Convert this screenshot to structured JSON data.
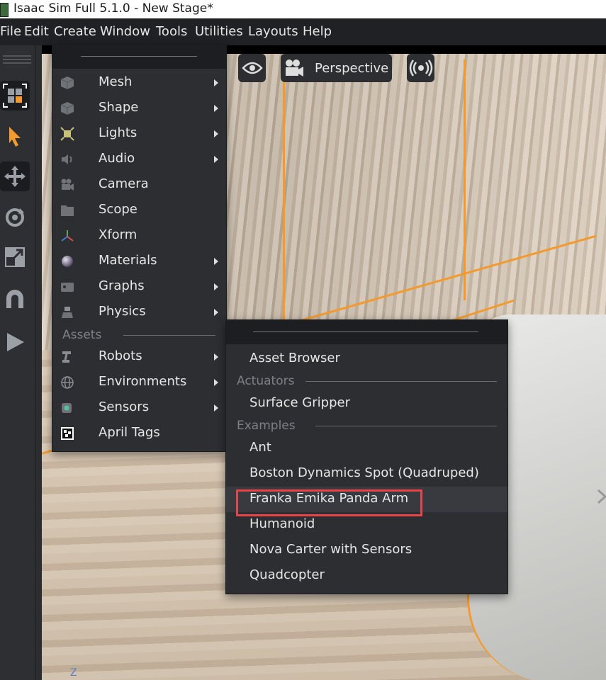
{
  "window": {
    "title": "Isaac Sim Full 5.1.0 - New Stage*"
  },
  "menubar": [
    "File",
    "Edit",
    "Create",
    "Window",
    "Tools",
    "Utilities",
    "Layouts",
    "Help"
  ],
  "toolbar": {
    "tools": [
      "selection-mode-icon",
      "select-arrow-icon",
      "move-icon",
      "rotate-icon",
      "scale-icon",
      "snap-magnet-icon",
      "play-icon"
    ]
  },
  "viewport": {
    "camera_label": "Perspective",
    "axis_label": "Z"
  },
  "create_menu": {
    "items": [
      {
        "label": "Mesh",
        "icon": "cube-icon",
        "submenu": true
      },
      {
        "label": "Shape",
        "icon": "shape-icon",
        "submenu": true
      },
      {
        "label": "Lights",
        "icon": "light-icon",
        "submenu": true
      },
      {
        "label": "Audio",
        "icon": "speaker-icon",
        "submenu": true
      },
      {
        "label": "Camera",
        "icon": "camera-icon",
        "submenu": false
      },
      {
        "label": "Scope",
        "icon": "folder-icon",
        "submenu": false
      },
      {
        "label": "Xform",
        "icon": "xform-axes-icon",
        "submenu": false
      },
      {
        "label": "Materials",
        "icon": "sphere-icon",
        "submenu": true
      },
      {
        "label": "Graphs",
        "icon": "graph-icon",
        "submenu": true
      },
      {
        "label": "Physics",
        "icon": "physics-icon",
        "submenu": true
      }
    ],
    "assets_section": "Assets",
    "asset_items": [
      {
        "label": "Robots",
        "icon": "robot-arm-icon",
        "submenu": true
      },
      {
        "label": "Environments",
        "icon": "globe-icon",
        "submenu": true
      },
      {
        "label": "Sensors",
        "icon": "sensor-icon",
        "submenu": true
      },
      {
        "label": "April Tags",
        "icon": "april-tag-icon",
        "submenu": false
      }
    ]
  },
  "robots_menu": {
    "asset_browser": "Asset Browser",
    "actuators_section": "Actuators",
    "actuators": [
      "Surface Gripper"
    ],
    "examples_section": "Examples",
    "examples": [
      "Ant",
      "Boston Dynamics Spot (Quadruped)",
      "Franka Emika Panda Arm",
      "Humanoid",
      "Nova Carter with Sensors",
      "Quadcopter"
    ],
    "highlighted_item": "Franka Emika Panda Arm"
  },
  "colors": {
    "accent_orange": "#f29a2e",
    "highlight_red": "#e8444a",
    "menu_bg": "#2c2e32"
  }
}
